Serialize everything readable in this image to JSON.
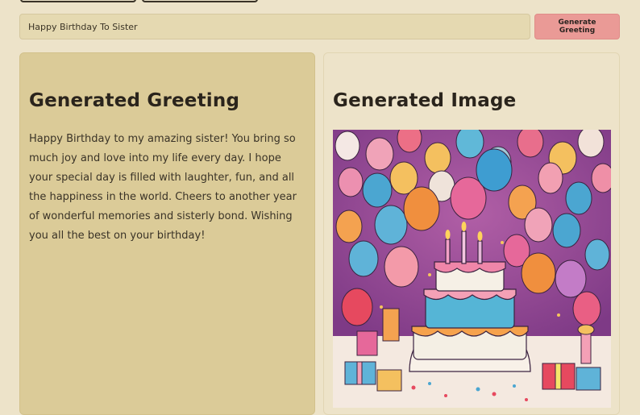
{
  "prompt": {
    "value": "Happy Birthday To Sister",
    "placeholder": ""
  },
  "generate_button": {
    "label": "Generate Greeting"
  },
  "greeting_panel": {
    "title": "Generated Greeting",
    "text": "Happy Birthday to my amazing sister! You bring so much joy and love into my life every day. I hope your special day is filled with laughter, fun, and all the happiness in the world. Cheers to another year of wonderful memories and sisterly bond. Wishing you all the best on your birthday!"
  },
  "image_panel": {
    "title": "Generated Image",
    "image_subject": "birthday-cake-and-balloons-illustration"
  },
  "colors": {
    "background": "#ede3c9",
    "greeting_panel_bg": "#dbcb98",
    "button_bg": "#ea9a96",
    "input_bg": "#e5d9b1"
  }
}
